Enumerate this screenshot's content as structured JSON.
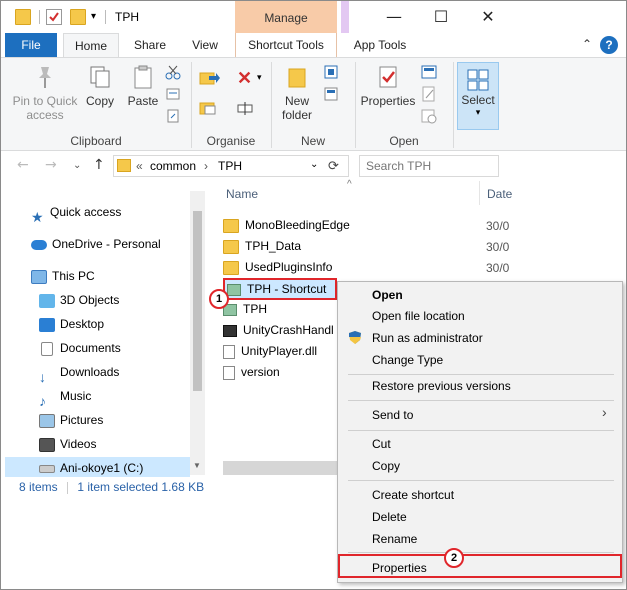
{
  "window": {
    "title": "TPH",
    "contextual_group": "Manage",
    "controls": {
      "minimize": "—",
      "maximize": "☐",
      "close": "✕"
    }
  },
  "ribbon_tabs": [
    "File",
    "Home",
    "Share",
    "View",
    "Shortcut Tools",
    "App Tools"
  ],
  "ribbon": {
    "clipboard": {
      "pin_line1": "Pin to Quick",
      "pin_line2": "access",
      "copy": "Copy",
      "paste": "Paste",
      "label": "Clipboard"
    },
    "organise": {
      "label": "Organise"
    },
    "new": {
      "new_folder_line1": "New",
      "new_folder_line2": "folder",
      "label": "New"
    },
    "open": {
      "properties": "Properties",
      "label": "Open"
    },
    "select": {
      "label": "Select"
    }
  },
  "address": {
    "prefix": "«",
    "path1": "common",
    "sep": "›",
    "path2": "TPH"
  },
  "search": {
    "placeholder": "Search TPH"
  },
  "nav_pane": [
    {
      "label": "Quick access",
      "icon": "star-icon"
    },
    {
      "label": "OneDrive - Personal",
      "icon": "cloud-icon"
    },
    {
      "label": "This PC",
      "icon": "computer-icon"
    },
    {
      "label": "3D Objects",
      "icon": "cube-icon"
    },
    {
      "label": "Desktop",
      "icon": "desktop-icon"
    },
    {
      "label": "Documents",
      "icon": "document-icon"
    },
    {
      "label": "Downloads",
      "icon": "download-icon"
    },
    {
      "label": "Music",
      "icon": "music-icon"
    },
    {
      "label": "Pictures",
      "icon": "picture-icon"
    },
    {
      "label": "Videos",
      "icon": "video-icon"
    },
    {
      "label": "Ani-okoye1 (C:)",
      "icon": "drive-icon"
    }
  ],
  "columns": {
    "name": "Name",
    "date": "Date"
  },
  "files": [
    {
      "name": "MonoBleedingEdge",
      "date": "30/0"
    },
    {
      "name": "TPH_Data",
      "date": "30/0"
    },
    {
      "name": "UsedPluginsInfo",
      "date": "30/0"
    },
    {
      "name": "TPH - Shortcut"
    },
    {
      "name": "TPH"
    },
    {
      "name": "UnityCrashHandl"
    },
    {
      "name": "UnityPlayer.dll"
    },
    {
      "name": "version"
    }
  ],
  "status": {
    "items": "8 items",
    "selected": "1 item selected  1.68 KB"
  },
  "context_menu": [
    "Open",
    "Open file location",
    "Run as administrator",
    "Change Type",
    "Restore previous versions",
    "Send to",
    "Cut",
    "Copy",
    "Create shortcut",
    "Delete",
    "Rename",
    "Properties"
  ],
  "annotations": {
    "step1": "1",
    "step2": "2"
  },
  "colors": {
    "accent": "#1d6fbf",
    "highlight": "#e0262b",
    "manage": "#f8cba8"
  }
}
